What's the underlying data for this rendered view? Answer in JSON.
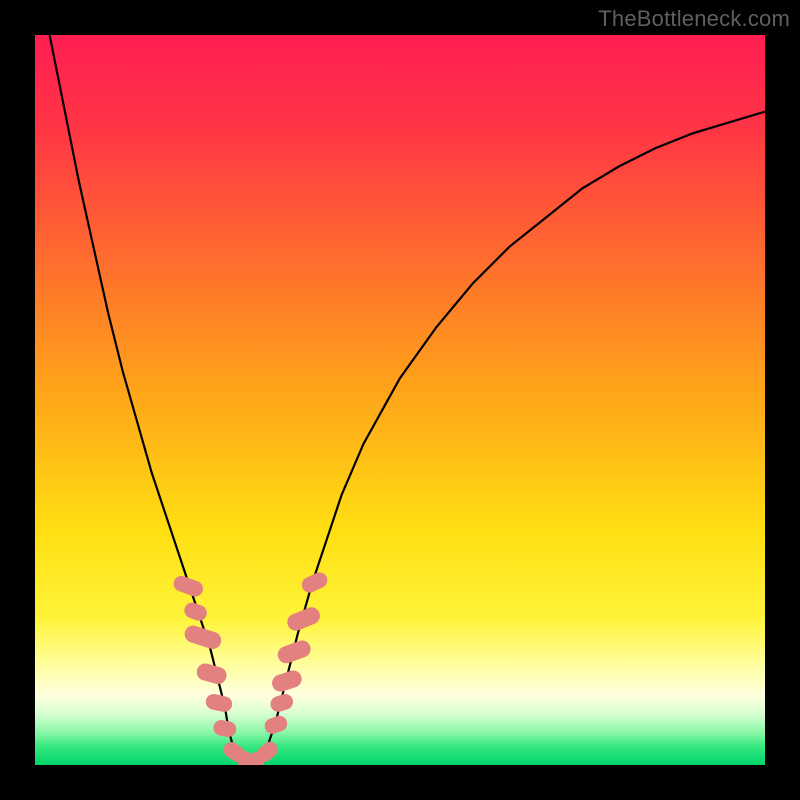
{
  "attribution": "TheBottleneck.com",
  "colors": {
    "frame": "#000000",
    "curve": "#000000",
    "marker": "#e38080",
    "gradient_stops": [
      {
        "offset": 0.0,
        "color": "#ff1e52"
      },
      {
        "offset": 0.12,
        "color": "#ff3346"
      },
      {
        "offset": 0.3,
        "color": "#ff6a2f"
      },
      {
        "offset": 0.48,
        "color": "#ffa21a"
      },
      {
        "offset": 0.68,
        "color": "#ffdf12"
      },
      {
        "offset": 0.8,
        "color": "#fff43a"
      },
      {
        "offset": 0.87,
        "color": "#ffffaa"
      },
      {
        "offset": 0.905,
        "color": "#ffffe0"
      },
      {
        "offset": 0.93,
        "color": "#d7ffd0"
      },
      {
        "offset": 0.955,
        "color": "#8cf7a8"
      },
      {
        "offset": 0.975,
        "color": "#35e880"
      },
      {
        "offset": 1.0,
        "color": "#00d46a"
      }
    ]
  },
  "chart_data": {
    "type": "line",
    "title": "",
    "xlabel": "",
    "ylabel": "",
    "xlim": [
      0,
      100
    ],
    "ylim": [
      0,
      100
    ],
    "grid": false,
    "legend": false,
    "annotations": [],
    "series": [
      {
        "name": "left-curve",
        "x": [
          2,
          4,
          6,
          8,
          10,
          12,
          14,
          16,
          18,
          20,
          22,
          23,
          24,
          25,
          26,
          26.5,
          27,
          28,
          29,
          30
        ],
        "y": [
          100,
          90,
          80,
          71,
          62,
          54,
          47,
          40,
          34,
          28,
          22,
          19,
          16,
          12,
          8,
          5,
          3,
          1.5,
          0.8,
          0.4
        ]
      },
      {
        "name": "right-curve",
        "x": [
          30,
          31,
          32,
          33,
          34,
          35,
          36,
          38,
          40,
          42,
          45,
          50,
          55,
          60,
          65,
          70,
          75,
          80,
          85,
          90,
          95,
          100
        ],
        "y": [
          0.4,
          1.2,
          3,
          6,
          10,
          14,
          18,
          25,
          31,
          37,
          44,
          53,
          60,
          66,
          71,
          75,
          79,
          82,
          84.5,
          86.5,
          88,
          89.5
        ]
      }
    ],
    "markers": [
      {
        "x": 21.0,
        "y": 24.5,
        "w": 2.0,
        "h": 4.0,
        "angle": -70
      },
      {
        "x": 22.0,
        "y": 21.0,
        "w": 2.0,
        "h": 3.0,
        "angle": -70
      },
      {
        "x": 23.0,
        "y": 17.5,
        "w": 2.2,
        "h": 5.0,
        "angle": -72
      },
      {
        "x": 24.2,
        "y": 12.5,
        "w": 2.2,
        "h": 4.0,
        "angle": -75
      },
      {
        "x": 25.2,
        "y": 8.5,
        "w": 2.0,
        "h": 3.5,
        "angle": -78
      },
      {
        "x": 26.0,
        "y": 5.0,
        "w": 2.0,
        "h": 3.0,
        "angle": -80
      },
      {
        "x": 27.3,
        "y": 1.8,
        "w": 2.0,
        "h": 3.0,
        "angle": -55
      },
      {
        "x": 28.8,
        "y": 0.6,
        "w": 2.0,
        "h": 2.5,
        "angle": -20
      },
      {
        "x": 30.3,
        "y": 0.5,
        "w": 2.0,
        "h": 2.5,
        "angle": 15
      },
      {
        "x": 31.8,
        "y": 1.8,
        "w": 2.0,
        "h": 3.0,
        "angle": 50
      },
      {
        "x": 33.0,
        "y": 5.5,
        "w": 2.0,
        "h": 3.0,
        "angle": 70
      },
      {
        "x": 33.8,
        "y": 8.5,
        "w": 2.0,
        "h": 3.0,
        "angle": 72
      },
      {
        "x": 34.5,
        "y": 11.5,
        "w": 2.2,
        "h": 4.0,
        "angle": 72
      },
      {
        "x": 35.5,
        "y": 15.5,
        "w": 2.2,
        "h": 4.5,
        "angle": 70
      },
      {
        "x": 36.8,
        "y": 20.0,
        "w": 2.2,
        "h": 4.5,
        "angle": 68
      },
      {
        "x": 38.3,
        "y": 25.0,
        "w": 2.0,
        "h": 3.5,
        "angle": 65
      }
    ]
  }
}
